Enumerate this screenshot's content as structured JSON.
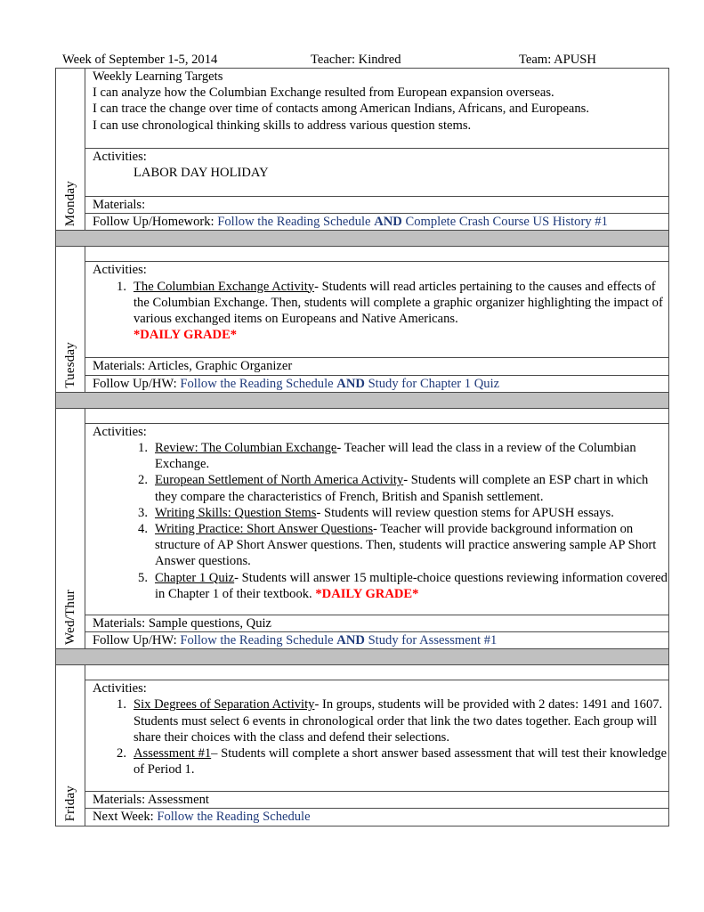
{
  "header": {
    "week": "Week of September 1-5, 2014",
    "teacher": "Teacher: Kindred",
    "team": "Team: APUSH"
  },
  "colors": {
    "link_blue": "#1f3a7a",
    "daily_grade_red": "#ff0000",
    "divider_gray": "#c0c0c0"
  },
  "monday": {
    "day": "Monday",
    "targets_title": "Weekly Learning Targets",
    "targets": [
      "I can analyze how the Columbian Exchange resulted from European expansion overseas.",
      "I can trace the change over time of contacts among American Indians, Africans, and Europeans.",
      "I can use chronological thinking skills to address various question stems."
    ],
    "activities_label": "Activities:",
    "activity_text": "LABOR DAY HOLIDAY",
    "materials": "Materials:",
    "followup_label": "Follow Up/Homework: ",
    "followup_part1": "Follow the Reading Schedule ",
    "followup_and": "AND",
    "followup_part2": " Complete Crash Course US History #1"
  },
  "tuesday": {
    "day": "Tuesday",
    "activities_label": "Activities:",
    "activities": [
      {
        "num": "1.",
        "title": "The Columbian Exchange Activity",
        "text": "- Students will read articles pertaining to the causes and effects of the Columbian Exchange. Then, students will complete a graphic organizer highlighting the impact of various exchanged items on Europeans and Native Americans.",
        "grade": "*DAILY GRADE*"
      }
    ],
    "materials": "Materials: Articles, Graphic Organizer",
    "followup_label": "Follow Up/HW: ",
    "followup_part1": "Follow the Reading Schedule ",
    "followup_and": "AND",
    "followup_part2": " Study for Chapter 1 Quiz"
  },
  "wedthur": {
    "day": "Wed/Thur",
    "activities_label": "Activities:",
    "activities": [
      {
        "num": "1.",
        "title": "Review: The Columbian Exchange",
        "text": "- Teacher will lead the class in a review of the Columbian Exchange."
      },
      {
        "num": "2.",
        "title": "European Settlement of North America Activity",
        "text": "- Students will complete an ESP chart in which they compare the characteristics of French, British and Spanish settlement."
      },
      {
        "num": "3.",
        "title": "Writing Skills: Question Stems",
        "text": "- Students will review question stems for APUSH essays."
      },
      {
        "num": "4.",
        "title": "Writing Practice: Short Answer Questions",
        "text": "- Teacher will provide background information on structure of AP Short Answer questions. Then, students will practice answering sample AP Short Answer questions."
      },
      {
        "num": "5.",
        "title": "Chapter 1 Quiz",
        "text": "- Students will answer 15 multiple-choice questions reviewing information covered in Chapter 1 of their textbook. ",
        "grade": "*DAILY GRADE*"
      }
    ],
    "materials": "Materials: Sample questions, Quiz",
    "followup_label": "Follow Up/HW: ",
    "followup_part1": "Follow the Reading Schedule ",
    "followup_and": "AND",
    "followup_part2": " Study for Assessment #1"
  },
  "friday": {
    "day": "Friday",
    "activities_label": "Activities:",
    "activities": [
      {
        "num": "1.",
        "title": "Six Degrees of Separation Activity",
        "text": "- In groups, students will be provided with 2 dates: 1491 and 1607. Students must select 6 events in chronological order that link the two dates together. Each group will share their choices with the class and defend their selections."
      },
      {
        "num": "2.",
        "title": "Assessment #1",
        "text": "– Students will complete a short answer based assessment that will test their knowledge of Period 1."
      }
    ],
    "materials": "Materials: Assessment",
    "next_label": "Next Week: ",
    "next_text": "Follow the Reading Schedule"
  }
}
